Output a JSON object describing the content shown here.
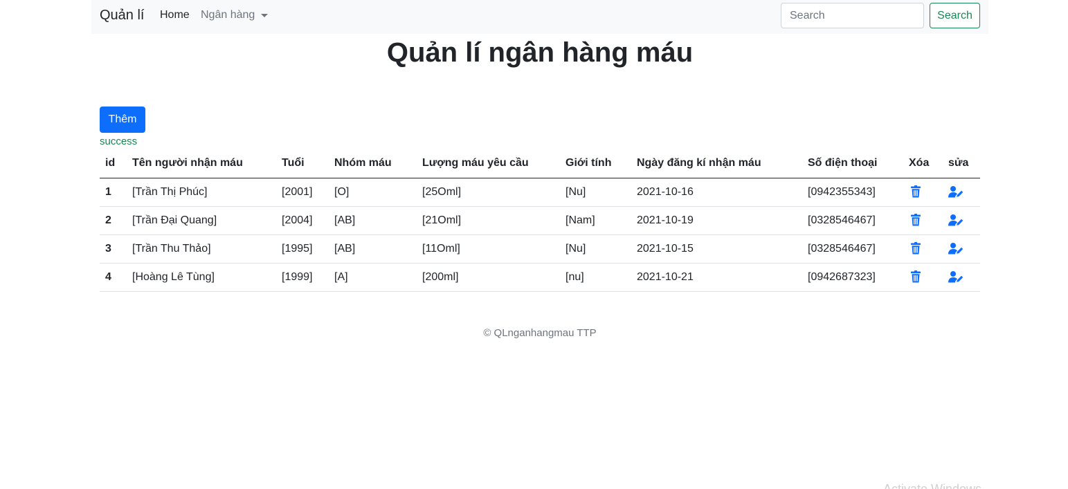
{
  "navbar": {
    "brand": "Quản lí",
    "home_label": "Home",
    "bank_label": "Ngân hàng",
    "search_placeholder": "Search",
    "search_button": "Search"
  },
  "page": {
    "title": "Quản lí ngân hàng máu",
    "add_button": "Thêm",
    "status_message": "success"
  },
  "table": {
    "headers": [
      "id",
      "Tên người nhận máu",
      "Tuổi",
      "Nhóm máu",
      "Lượng máu yêu cầu",
      "Giới tính",
      "Ngày đăng kí nhận máu",
      "Số điện thoại",
      "Xóa",
      "sửa"
    ],
    "rows": [
      {
        "id": "1",
        "name": "[Trần Thị Phúc]",
        "age": "[2001]",
        "blood_group": "[O]",
        "amount": "[25Oml]",
        "gender": "[Nu]",
        "date": "2021-10-16",
        "phone": "[0942355343]"
      },
      {
        "id": "2",
        "name": "[Trần Đại Quang]",
        "age": "[2004]",
        "blood_group": "[AB]",
        "amount": "[21Oml]",
        "gender": "[Nam]",
        "date": "2021-10-19",
        "phone": "[0328546467]"
      },
      {
        "id": "3",
        "name": "[Trần Thu Thảo]",
        "age": "[1995]",
        "blood_group": "[AB]",
        "amount": "[11Oml]",
        "gender": "[Nu]",
        "date": "2021-10-15",
        "phone": "[0328546467]"
      },
      {
        "id": "4",
        "name": "[Hoàng Lê Tùng]",
        "age": "[1999]",
        "blood_group": "[A]",
        "amount": "[200ml]",
        "gender": "[nu]",
        "date": "2021-10-21",
        "phone": "[0942687323]"
      }
    ],
    "delete_icon": "trash-icon",
    "edit_icon": "user-edit-icon"
  },
  "footer": {
    "text": "© QLnganhangmau TTP"
  },
  "watermark": {
    "text": "Activate Windows"
  },
  "colors": {
    "primary": "#0d6efd",
    "success": "#198754",
    "navbar_bg": "#f8f9fa",
    "muted": "#6c757d"
  }
}
